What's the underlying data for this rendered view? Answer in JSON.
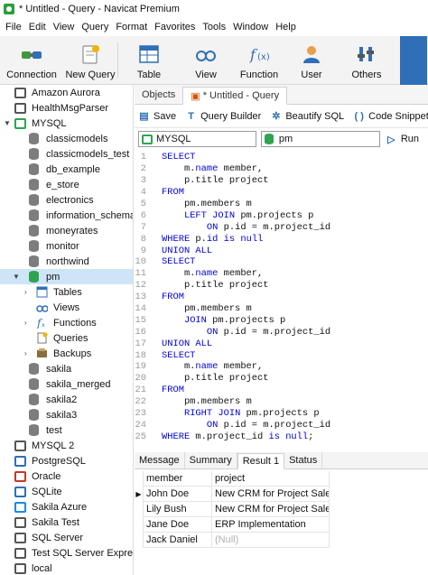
{
  "window": {
    "title": "* Untitled - Query - Navicat Premium"
  },
  "menu": [
    "File",
    "Edit",
    "View",
    "Query",
    "Format",
    "Favorites",
    "Tools",
    "Window",
    "Help"
  ],
  "toolbar": {
    "connection": "Connection",
    "new_query": "New Query",
    "table": "Table",
    "view": "View",
    "function": "Function",
    "user": "User",
    "others": "Others"
  },
  "sidebar": {
    "top_items": [
      "Amazon Aurora",
      "HealthMsgParser",
      "MYSQL"
    ],
    "databases": [
      "classicmodels",
      "classicmodels_test",
      "db_example",
      "e_store",
      "electronics",
      "information_schema",
      "moneyrates",
      "monitor",
      "northwind"
    ],
    "pm": "pm",
    "pm_children": [
      "Tables",
      "Views",
      "Functions",
      "Queries",
      "Backups"
    ],
    "more_databases": [
      "sakila",
      "sakila_merged",
      "sakila2",
      "sakila3",
      "test"
    ],
    "connections": [
      "MYSQL 2",
      "PostgreSQL",
      "Oracle",
      "SQLite",
      "Sakila Azure",
      "Sakila Test",
      "SQL Server",
      "Test SQL Server Express",
      "local"
    ]
  },
  "tabs": {
    "objects": "Objects",
    "query": "* Untitled - Query"
  },
  "query_toolbar": {
    "save": "Save",
    "builder": "Query Builder",
    "beautify": "Beautify SQL",
    "snippet": "Code Snippet"
  },
  "connection_bar": {
    "connection": "MYSQL",
    "database": "pm",
    "run": "Run"
  },
  "sql_lines": [
    [
      [
        "kw",
        "SELECT"
      ]
    ],
    [
      [
        "t",
        "    m."
      ],
      [
        "kw",
        "name"
      ],
      [
        "t",
        " member,"
      ]
    ],
    [
      [
        "t",
        "    p.title project"
      ]
    ],
    [
      [
        "kw",
        "FROM"
      ]
    ],
    [
      [
        "t",
        "    pm.members m"
      ]
    ],
    [
      [
        "t",
        "    "
      ],
      [
        "kw",
        "LEFT JOIN"
      ],
      [
        "t",
        " pm.projects p"
      ]
    ],
    [
      [
        "t",
        "        "
      ],
      [
        "kw",
        "ON"
      ],
      [
        "t",
        " p.id = m.project_id"
      ]
    ],
    [
      [
        "kw",
        "WHERE"
      ],
      [
        "t",
        " p."
      ],
      [
        "kw",
        "id"
      ],
      [
        "t",
        " "
      ],
      [
        "kw",
        "is null"
      ]
    ],
    [
      [
        "kw",
        "UNION ALL"
      ]
    ],
    [
      [
        "kw",
        "SELECT"
      ]
    ],
    [
      [
        "t",
        "    m."
      ],
      [
        "kw",
        "name"
      ],
      [
        "t",
        " member,"
      ]
    ],
    [
      [
        "t",
        "    p.title project"
      ]
    ],
    [
      [
        "kw",
        "FROM"
      ]
    ],
    [
      [
        "t",
        "    pm.members m"
      ]
    ],
    [
      [
        "t",
        "    "
      ],
      [
        "kw",
        "JOIN"
      ],
      [
        "t",
        " pm.projects p"
      ]
    ],
    [
      [
        "t",
        "        "
      ],
      [
        "kw",
        "ON"
      ],
      [
        "t",
        " p.id = m.project_id"
      ]
    ],
    [
      [
        "kw",
        "UNION ALL"
      ]
    ],
    [
      [
        "kw",
        "SELECT"
      ]
    ],
    [
      [
        "t",
        "    m."
      ],
      [
        "kw",
        "name"
      ],
      [
        "t",
        " member,"
      ]
    ],
    [
      [
        "t",
        "    p.title project"
      ]
    ],
    [
      [
        "kw",
        "FROM"
      ]
    ],
    [
      [
        "t",
        "    pm.members m"
      ]
    ],
    [
      [
        "t",
        "    "
      ],
      [
        "kw",
        "RIGHT JOIN"
      ],
      [
        "t",
        " pm.projects p"
      ]
    ],
    [
      [
        "t",
        "        "
      ],
      [
        "kw",
        "ON"
      ],
      [
        "t",
        " p.id = m.project_id"
      ]
    ],
    [
      [
        "kw",
        "WHERE"
      ],
      [
        "t",
        " m.project_id "
      ],
      [
        "kw",
        "is null"
      ],
      [
        "t",
        ";"
      ]
    ]
  ],
  "result_tabs": [
    "Message",
    "Summary",
    "Result 1",
    "Status"
  ],
  "results": {
    "columns": [
      "member",
      "project"
    ],
    "rows": [
      [
        "John Doe",
        "New CRM for Project Sales"
      ],
      [
        "Lily Bush",
        "New CRM for Project Sales"
      ],
      [
        "Jane Doe",
        "ERP Implementation"
      ],
      [
        "Jack Daniel",
        "(Null)"
      ]
    ]
  }
}
